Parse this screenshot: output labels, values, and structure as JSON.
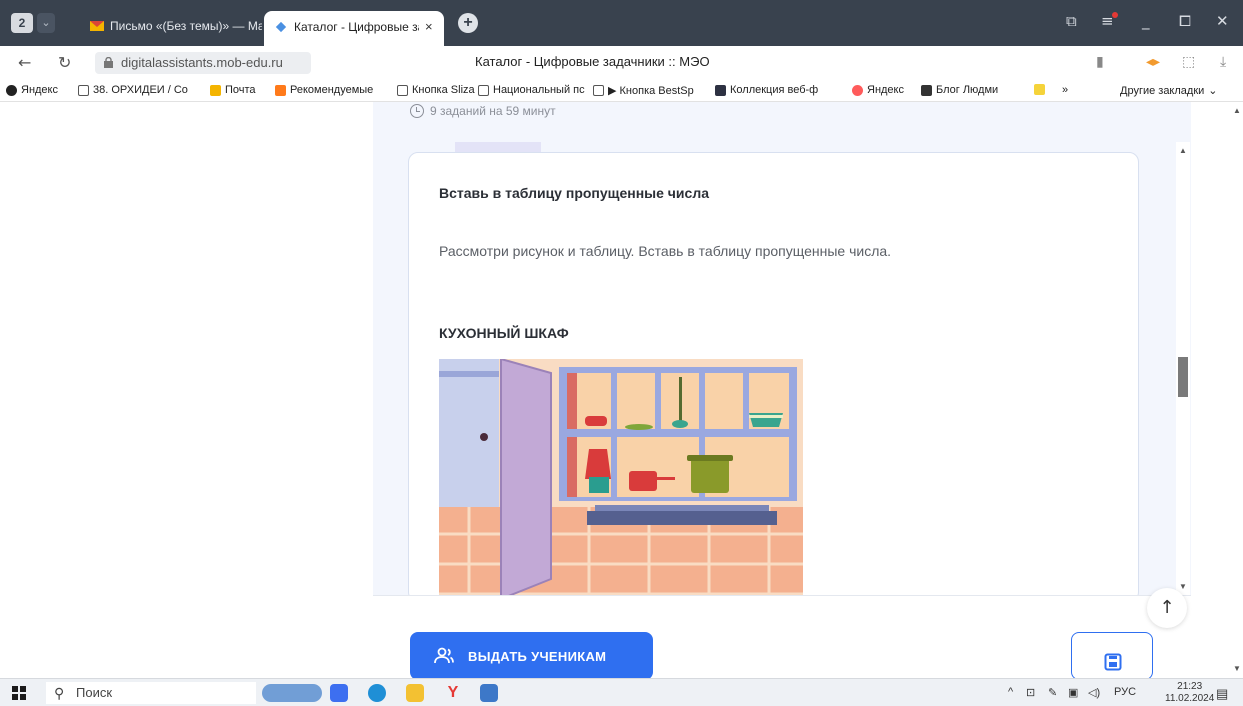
{
  "browser": {
    "tab_count": "2",
    "tabs": [
      {
        "label": "Письмо «(Без темы)» — Mail",
        "icon": "mail-icon"
      },
      {
        "label": "Каталог - Цифровые задачники",
        "icon": "site-icon"
      }
    ],
    "url": "digitalassistants.mob-edu.ru",
    "page_title": "Каталог - Цифровые задачники :: МЭО"
  },
  "bookmarks": [
    {
      "label": "Яндекс",
      "icon": "yandex-icon"
    },
    {
      "label": "38. ОРХИДЕИ / Со",
      "icon": "page-icon"
    },
    {
      "label": "Почта",
      "icon": "mail-icon"
    },
    {
      "label": "Рекомендуемые",
      "icon": "rec-icon"
    },
    {
      "label": "Кнопка Sliza",
      "icon": "page-icon"
    },
    {
      "label": "Национальный пс",
      "icon": "page-icon"
    },
    {
      "label": "▶ Кнопка BestSp",
      "icon": "page-icon"
    },
    {
      "label": "Коллекция веб-ф",
      "icon": "collection-icon"
    },
    {
      "label": "Яндекс",
      "icon": "yandex-red-icon"
    },
    {
      "label": "Блог Людми",
      "icon": "blog-icon"
    },
    {
      "label": "»",
      "icon": "more-icon"
    },
    {
      "label": "Другие закладки",
      "icon": "chevron-down-icon"
    }
  ],
  "assignment": {
    "meta": "9 заданий на 59 минут",
    "task_title": "Вставь в таблицу пропущенные числа",
    "task_desc": "Рассмотри рисунок и таблицу. Вставь в таблицу пропущенные числа.",
    "section_title": "КУХОННЫЙ ШКАФ",
    "issue_button": "ВЫДАТЬ УЧЕНИКАМ"
  },
  "taskbar": {
    "search_placeholder": "Поиск",
    "language": "РУС",
    "time": "21:23",
    "date": "11.02.2024"
  },
  "colors": {
    "accent": "#2f6ff0",
    "tabbar": "#39424e"
  }
}
